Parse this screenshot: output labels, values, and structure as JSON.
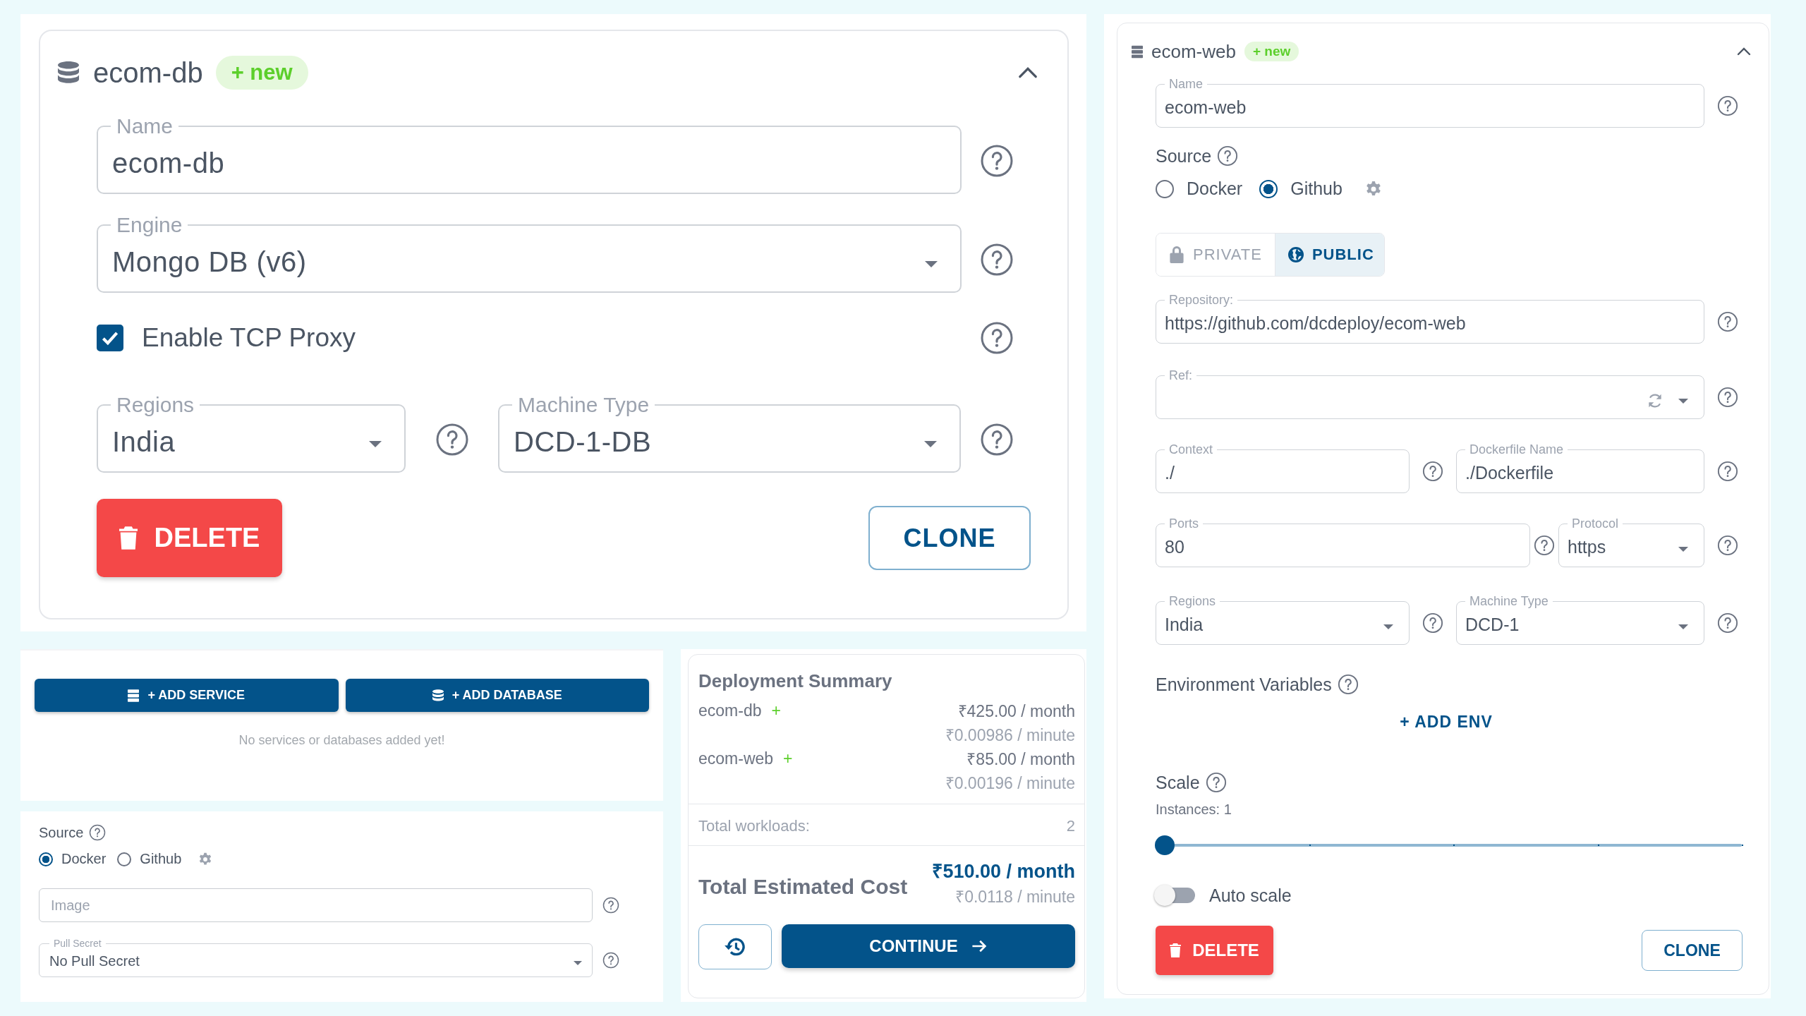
{
  "db_card": {
    "title": "ecom-db",
    "badge": "+ new",
    "expanded": true,
    "name": {
      "label": "Name",
      "value": "ecom-db"
    },
    "engine": {
      "label": "Engine",
      "value": "Mongo DB (v6)"
    },
    "tcp_proxy": {
      "label": "Enable TCP Proxy",
      "checked": true
    },
    "regions": {
      "label": "Regions",
      "value": "India"
    },
    "machine_type": {
      "label": "Machine Type",
      "value": "DCD-1-DB"
    },
    "delete_button": "DELETE",
    "clone_button": "CLONE"
  },
  "add_panel": {
    "buttons": [
      {
        "label": "+ ADD SERVICE",
        "kind": "service"
      },
      {
        "label": "+ ADD DATABASE",
        "kind": "database"
      }
    ],
    "empty_message": "No services or databases added yet!"
  },
  "source_panel": {
    "label": "Source",
    "options": [
      {
        "label": "Docker",
        "selected": true
      },
      {
        "label": "Github",
        "selected": false
      }
    ],
    "image": {
      "placeholder": "Image"
    },
    "pull_secret": {
      "label": "Pull Secret",
      "value": "No Pull Secret"
    }
  },
  "summary": {
    "title": "Deployment Summary",
    "items": [
      {
        "name": "ecom-db",
        "mark": "+",
        "monthly": "₹425.00 / month",
        "per_minute": "₹0.00986 / minute"
      },
      {
        "name": "ecom-web",
        "mark": "+",
        "monthly": "₹85.00 / month",
        "per_minute": "₹0.00196 / minute"
      }
    ],
    "total_workloads": {
      "label": "Total workloads:",
      "value": "2"
    },
    "total": {
      "label": "Total Estimated Cost",
      "monthly": "₹510.00 / month",
      "per_minute": "₹0.0118 / minute"
    },
    "continue_button": "CONTINUE"
  },
  "web_card": {
    "title": "ecom-web",
    "badge": "+ new",
    "expanded": true,
    "name": {
      "label": "Name",
      "value": "ecom-web"
    },
    "source": {
      "label": "Source",
      "options": [
        {
          "label": "Docker",
          "selected": false
        },
        {
          "label": "Github",
          "selected": true
        }
      ]
    },
    "visibility": [
      {
        "label": "PRIVATE",
        "kind": "private",
        "selected": false
      },
      {
        "label": "PUBLIC",
        "kind": "public",
        "selected": true
      }
    ],
    "repository": {
      "label": "Repository:",
      "value": "https://github.com/dcdeploy/ecom-web"
    },
    "ref": {
      "label": "Ref:"
    },
    "context": {
      "label": "Context",
      "value": "./"
    },
    "dockerfile": {
      "label": "Dockerfile Name",
      "value": "./Dockerfile"
    },
    "ports": {
      "label": "Ports",
      "value": "80"
    },
    "protocol": {
      "label": "Protocol",
      "value": "https"
    },
    "regions": {
      "label": "Regions",
      "value": "India"
    },
    "machine_type": {
      "label": "Machine Type",
      "value": "DCD-1"
    },
    "env": {
      "label": "Environment Variables",
      "add_button": "+ ADD ENV"
    },
    "scale": {
      "label": "Scale",
      "instances": "Instances: 1",
      "level": 0
    },
    "auto_scale": {
      "label": "Auto scale",
      "on": false
    },
    "delete_button": "DELETE",
    "clone_button": "CLONE"
  }
}
